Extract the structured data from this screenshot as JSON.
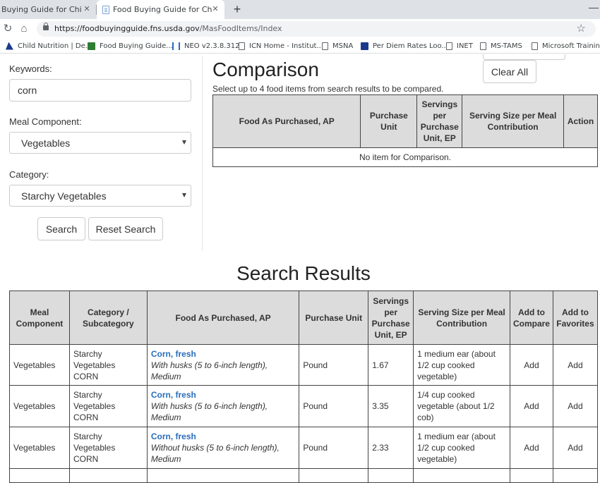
{
  "browser": {
    "tabs": [
      {
        "title": "Buying Guide for Child Nut"
      },
      {
        "title": "Food Buying Guide for Child Nut"
      }
    ],
    "url_domain": "https://foodbuyingguide.fns.usda.gov",
    "url_path": "/MasFoodItems/Index",
    "bookmarks": [
      {
        "label": "Child Nutrition | De...",
        "icon": "flag-icon"
      },
      {
        "label": "Food Buying Guide...",
        "icon": "usda-icon"
      },
      {
        "label": "NEO v2.3.8.312",
        "icon": "neo-icon"
      },
      {
        "label": "ICN Home - Institut...",
        "icon": "page-icon"
      },
      {
        "label": "MSNA",
        "icon": "page-icon"
      },
      {
        "label": "Per Diem Rates Loo...",
        "icon": "gvc-icon"
      },
      {
        "label": "INET",
        "icon": "page-icon"
      },
      {
        "label": "MS-TAMS",
        "icon": "page-icon"
      },
      {
        "label": "Microsoft Training",
        "icon": "page-icon"
      }
    ]
  },
  "search_form": {
    "keywords_label": "Keywords:",
    "keywords_value": "corn",
    "meal_component_label": "Meal Component:",
    "meal_component_value": "Vegetables",
    "category_label": "Category:",
    "category_value": "Starchy Vegetables",
    "search_button": "Search",
    "reset_button": "Reset Search"
  },
  "comparison": {
    "title": "Comparison",
    "clear_button": "Clear All",
    "subtitle": "Select up to 4 food items from search results to be compared.",
    "headers": [
      "Food As Purchased, AP",
      "Purchase Unit",
      "Servings per Purchase Unit, EP",
      "Serving Size per Meal Contribution",
      "Action"
    ],
    "empty_message": "No item for Comparison."
  },
  "results": {
    "title": "Search Results",
    "headers": [
      "Meal Component",
      "Category / Subcategory",
      "Food As Purchased, AP",
      "Purchase Unit",
      "Servings per Purchase Unit, EP",
      "Serving Size per Meal Contribution",
      "Add to Compare",
      "Add to Favorites"
    ],
    "rows": [
      {
        "meal_component": "Vegetables",
        "category": "Starchy Vegetables",
        "subcategory": "CORN",
        "food_name": "Corn, fresh",
        "food_desc": "With husks (5 to 6-inch length), Medium",
        "unit": "Pound",
        "servings": "1.67",
        "serving_size": "1 medium ear (about 1/2 cup cooked vegetable)",
        "add_compare": "Add",
        "add_favorite": "Add"
      },
      {
        "meal_component": "Vegetables",
        "category": "Starchy Vegetables",
        "subcategory": "CORN",
        "food_name": "Corn, fresh",
        "food_desc": "With husks (5 to 6-inch length), Medium",
        "unit": "Pound",
        "servings": "3.35",
        "serving_size": "1/4 cup cooked vegetable (about 1/2 cob)",
        "add_compare": "Add",
        "add_favorite": "Add"
      },
      {
        "meal_component": "Vegetables",
        "category": "Starchy Vegetables",
        "subcategory": "CORN",
        "food_name": "Corn, fresh",
        "food_desc": "Without husks (5 to 6-inch length), Medium",
        "unit": "Pound",
        "servings": "2.33",
        "serving_size": "1 medium ear (about 1/2 cup cooked vegetable)",
        "add_compare": "Add",
        "add_favorite": "Add"
      }
    ]
  }
}
